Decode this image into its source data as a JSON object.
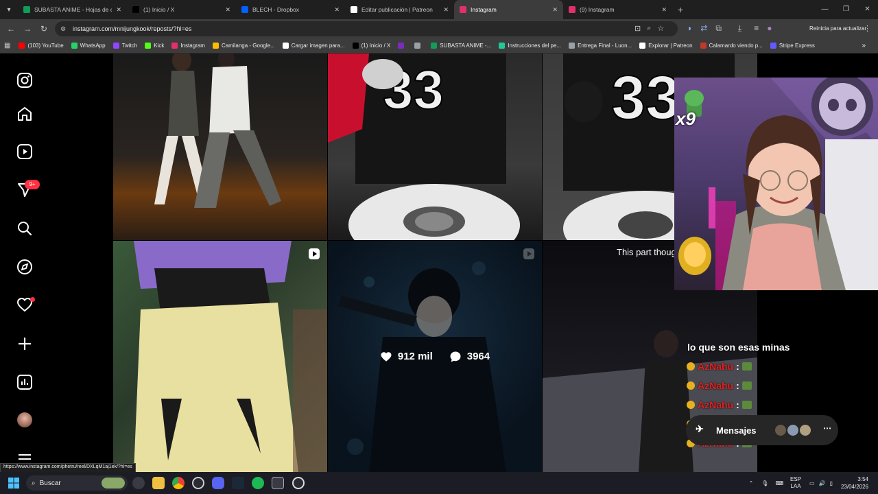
{
  "browser": {
    "tabs": [
      {
        "title": "SUBASTA ANIME - Hojas de cálc",
        "color": "#0f9d58"
      },
      {
        "title": "(1) Inicio / X",
        "color": "#000000"
      },
      {
        "title": "BLECH - Dropbox",
        "color": "#0061fe"
      },
      {
        "title": "Editar publicación | Patreon",
        "color": "#ffffff"
      },
      {
        "title": "Instagram",
        "color": "#e1306c"
      },
      {
        "title": "(9) Instagram",
        "color": "#e1306c"
      }
    ],
    "active_tab": 4,
    "url": "instagram.com/mnijungkook/reposts/?hl=es",
    "update_label": "Reinicia para actualizar",
    "bookmarks": [
      {
        "label": "(103) YouTube",
        "color": "#ff0000"
      },
      {
        "label": "WhatsApp",
        "color": "#25d366"
      },
      {
        "label": "Twitch",
        "color": "#9146ff"
      },
      {
        "label": "Kick",
        "color": "#53fc18"
      },
      {
        "label": "Instagram",
        "color": "#e1306c"
      },
      {
        "label": "Camilanga - Google...",
        "color": "#fbbc04"
      },
      {
        "label": "Cargar imagen para...",
        "color": "#ffffff"
      },
      {
        "label": "(1) Inicio / X",
        "color": "#000000"
      },
      {
        "label": "",
        "color": "#7b2cbf"
      },
      {
        "label": "",
        "color": "#9aa0a6"
      },
      {
        "label": "SUBASTA ANIME -...",
        "color": "#0f9d58"
      },
      {
        "label": "Instrucciones del pe...",
        "color": "#20c997"
      },
      {
        "label": "Entrega Final - Luon...",
        "color": "#9aa0a6"
      },
      {
        "label": "Explorar | Patreon",
        "color": "#ffffff"
      },
      {
        "label": "Calamardo viendo p...",
        "color": "#c0392b"
      },
      {
        "label": "Stripe Express",
        "color": "#635bff"
      }
    ]
  },
  "instagram": {
    "notifications_badge": "9+",
    "hover_post": {
      "likes": "912 mil",
      "comments": "3964"
    }
  },
  "stream": {
    "caption": "This part thoug",
    "multiplier": "x9",
    "chat_header": "lo que son esas minas",
    "chat_user": "AzNahu",
    "chat_sep": ":",
    "messages_label": "Mensajes"
  },
  "status_url": "https://www.instagram.com/phetru/reel/DXLqM1aj1ek/?hl=es",
  "taskbar": {
    "search_label": "Buscar",
    "lang": "ESP",
    "lang2": "LAA",
    "time": "3:54",
    "date": "23/04/2026"
  }
}
